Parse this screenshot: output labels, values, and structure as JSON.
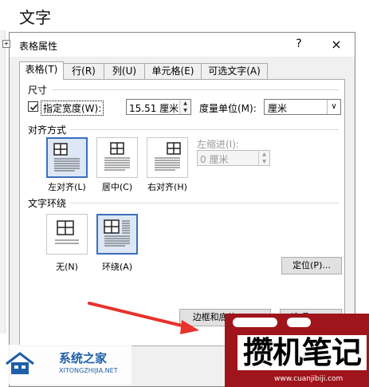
{
  "document": {
    "title": "文字",
    "move_handle": "+"
  },
  "dialog": {
    "title": "表格属性",
    "help": "?",
    "close": "×",
    "tabs": [
      {
        "label": "表格(T)",
        "active": true
      },
      {
        "label": "行(R)",
        "active": false
      },
      {
        "label": "列(U)",
        "active": false
      },
      {
        "label": "单元格(E)",
        "active": false
      },
      {
        "label": "可选文字(A)",
        "active": false
      }
    ],
    "size": {
      "section": "尺寸",
      "preferred_width_label": "指定宽度(W):",
      "preferred_width_checked": true,
      "width_value": "15.51 厘米",
      "unit_label": "度量单位(M):",
      "unit_value": "厘米"
    },
    "alignment": {
      "section": "对齐方式",
      "options": [
        {
          "label": "左对齐(L)",
          "selected": true
        },
        {
          "label": "居中(C)",
          "selected": false
        },
        {
          "label": "右对齐(H)",
          "selected": false
        }
      ],
      "indent_label": "左缩进(I):",
      "indent_value": "0 厘米"
    },
    "wrapping": {
      "section": "文字环绕",
      "options": [
        {
          "label": "无(N)",
          "selected": false
        },
        {
          "label": "环绕(A)",
          "selected": true
        }
      ],
      "positioning_button": "定位(P)..."
    },
    "footer": {
      "borders_button": "边框和底纹(B)...",
      "options_button": "选项(O)..."
    }
  },
  "colors": {
    "selected_border": "#3b6fbd",
    "annotation_arrow": "#e8322b",
    "watermark_red": "#a0141b"
  },
  "watermarks": {
    "left_title": "系统之家",
    "left_subtitle": "XITONGZHIJIA.NET",
    "right_title": "攒机笔记",
    "right_url": "www.cuanjibiji.com"
  }
}
